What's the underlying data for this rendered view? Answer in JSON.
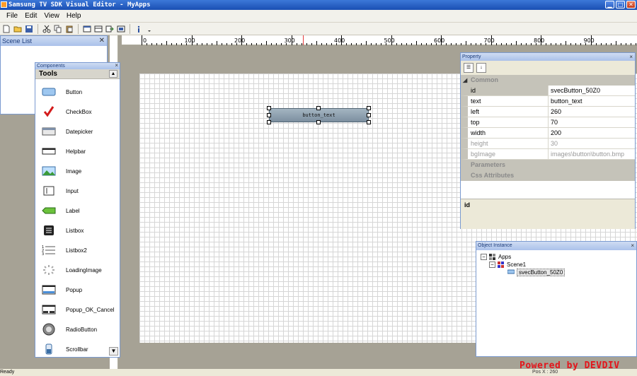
{
  "window": {
    "title": "Samsung TV SDK Visual Editor - MyApps",
    "minimize": "▁",
    "maximize": "□",
    "close": "✕"
  },
  "menu": [
    "File",
    "Edit",
    "View",
    "Help"
  ],
  "scene_list": {
    "title": "Scene List",
    "close": "✕"
  },
  "ruler": {
    "labels": [
      "0",
      "100",
      "200",
      "300",
      "400",
      "500",
      "600",
      "700",
      "800",
      "900"
    ]
  },
  "canvas": {
    "widget_text": "button_text"
  },
  "components": {
    "title": "Components",
    "close": "×",
    "tools_header": "Tools",
    "items": [
      {
        "label": "Button",
        "icon": "button-icon"
      },
      {
        "label": "CheckBox",
        "icon": "checkbox-icon"
      },
      {
        "label": "Datepicker",
        "icon": "datepicker-icon"
      },
      {
        "label": "Helpbar",
        "icon": "helpbar-icon"
      },
      {
        "label": "Image",
        "icon": "image-icon"
      },
      {
        "label": "Input",
        "icon": "input-icon"
      },
      {
        "label": "Label",
        "icon": "label-icon"
      },
      {
        "label": "Listbox",
        "icon": "listbox-icon"
      },
      {
        "label": "Listbox2",
        "icon": "listbox2-icon"
      },
      {
        "label": "LoadingImage",
        "icon": "loadingimage-icon"
      },
      {
        "label": "Popup",
        "icon": "popup-icon"
      },
      {
        "label": "Popup_OK_Cancel",
        "icon": "popup-ok-cancel-icon"
      },
      {
        "label": "RadioButton",
        "icon": "radiobutton-icon"
      },
      {
        "label": "Scrollbar",
        "icon": "scrollbar-icon"
      }
    ]
  },
  "property": {
    "title": "Property",
    "close": "×",
    "section_common": "Common",
    "rows": [
      {
        "key": "id",
        "value": "svecButton_50Z0"
      },
      {
        "key": "text",
        "value": "button_text"
      },
      {
        "key": "left",
        "value": "260"
      },
      {
        "key": "top",
        "value": "70"
      },
      {
        "key": "width",
        "value": "200"
      },
      {
        "key": "height",
        "value": "30"
      },
      {
        "key": "bgImage",
        "value": "images\\button\\button.bmp"
      }
    ],
    "section_parameters": "Parameters",
    "section_css": "Css Attributes",
    "description": "id"
  },
  "object_instance": {
    "title": "Object Instance",
    "close": "×",
    "tree": [
      {
        "label": "Apps",
        "expander": "−"
      },
      {
        "label": "Scene1",
        "expander": "−"
      },
      {
        "label": "svecButton_50Z0",
        "expander": ""
      }
    ]
  },
  "status": {
    "text": "Ready",
    "pos": "Pos X : 260"
  },
  "watermark": "Powered by DEVDIV"
}
